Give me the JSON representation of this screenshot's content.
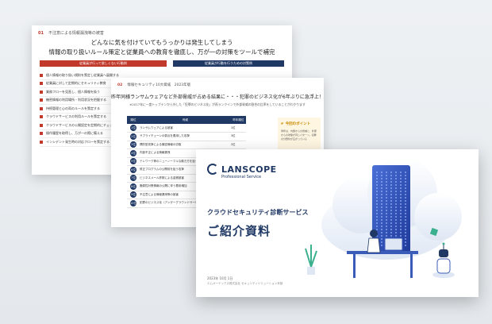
{
  "slide1": {
    "header_tag": "01",
    "header_text": "不注意による情報漏洩等の被害",
    "headline_1": "どんなに気を付けていてもうっかりは発生してしまう",
    "headline_2": "情報の取り扱いルール策定と従業員への教育を徹底し、万が一の対策をツールで補完",
    "bar_left": "従業員が行って欲しくない行動例",
    "bar_right": "従業員が行動を行うための対策例",
    "items": [
      "個人情報の取り扱い規則を策定し従業員へ展開する",
      "従業員に対して定期的にセキュリティ教育",
      "業務フローを見直し、個人情報を扱う",
      "機密情報の利用場所・利用状況を把握する",
      "持続管理と心の両のルールを策定する",
      "クラウドサービスの利用ルールを策定する",
      "クラウドサービスの公開設定を定期的にチェック",
      "操作履歴を取得し、万が一の際に備える",
      "インシデント発生時の対応フローを策定する"
    ]
  },
  "slide2": {
    "header_tag": "02",
    "header_text": "情報セキュリティ10大脅威　2023年版",
    "headline": "昨年同様ランサムウェアなど外部脅威が占める結果に・・・犯罪のビジネス化が6年ぶりに急浮上！",
    "subline": "※2017年に一度トップテンから外した「犯罪のビジネス化」が再ランクインで外部脅威の割合の比率をしていることがわかります",
    "col_rank": "順位",
    "col_threat": "脅威",
    "col_prev": "昨年順位",
    "rows": [
      {
        "rank": "1位",
        "threat": "ランサムウェアによる被害",
        "prev": "1位"
      },
      {
        "rank": "2位",
        "threat": "サプライチェーンの弱点を悪用した攻撃",
        "prev": "3位"
      },
      {
        "rank": "3位",
        "threat": "標的型攻撃による機密情報の窃取",
        "prev": "2位"
      },
      {
        "rank": "4位",
        "threat": "内部不正による情報漏洩",
        "prev": "5位"
      },
      {
        "rank": "5位",
        "threat": "テレワーク等のニューノーマルな働き方を狙った攻撃",
        "prev": "4位"
      },
      {
        "rank": "6位",
        "threat": "修正プログラムの公開前を狙う攻撃",
        "prev": "7位"
      },
      {
        "rank": "7位",
        "threat": "ビジネスメール詐欺による金銭被害",
        "prev": "8位"
      },
      {
        "rank": "8位",
        "threat": "脆弱性対策情報の公開に伴う悪用増加",
        "prev": "6位"
      },
      {
        "rank": "9位",
        "threat": "不注意による情報漏洩等の被害",
        "prev": "10位"
      },
      {
        "rank": "10位",
        "threat": "犯罪のビジネス化（アンダーグラウンドサービス）",
        "prev": "圏外"
      }
    ],
    "point_title": "今回のポイント",
    "point_body": "例年は、内部からの脅威と、外部からの攻撃が同じパターン。犯罪の分野化が広がっている"
  },
  "slide3": {
    "logo_text": "LANSCOPE",
    "logo_sub": "Professional Service",
    "subtitle": "クラウドセキュリティ診断サービス",
    "title": "ご紹介資料",
    "date": "2023年 10月 1日",
    "company": "エムオーテックス株式会社 セキュリティソリューション本部"
  },
  "colors": {
    "accent_red": "#c0392b",
    "navy": "#1f3864",
    "point_bg": "#fff6e2"
  }
}
